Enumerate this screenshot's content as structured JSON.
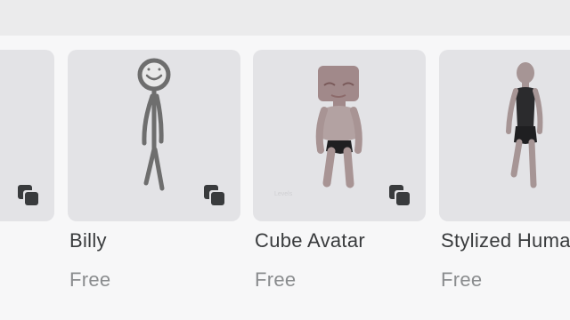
{
  "items": [
    {
      "name": "",
      "price": ""
    },
    {
      "name": "Billy",
      "price": "Free",
      "icon": "bundle-icon"
    },
    {
      "name": "Cube Avatar",
      "price": "Free",
      "icon": "bundle-icon",
      "watermark": "Levels"
    },
    {
      "name": "Stylized Human",
      "price": "Free",
      "icon": "bundle-icon"
    }
  ],
  "colors": {
    "card_bg": "#e3e3e6",
    "page_bg": "#f7f7f8",
    "name_text": "#393b3d",
    "price_text": "#8a8c8e"
  }
}
